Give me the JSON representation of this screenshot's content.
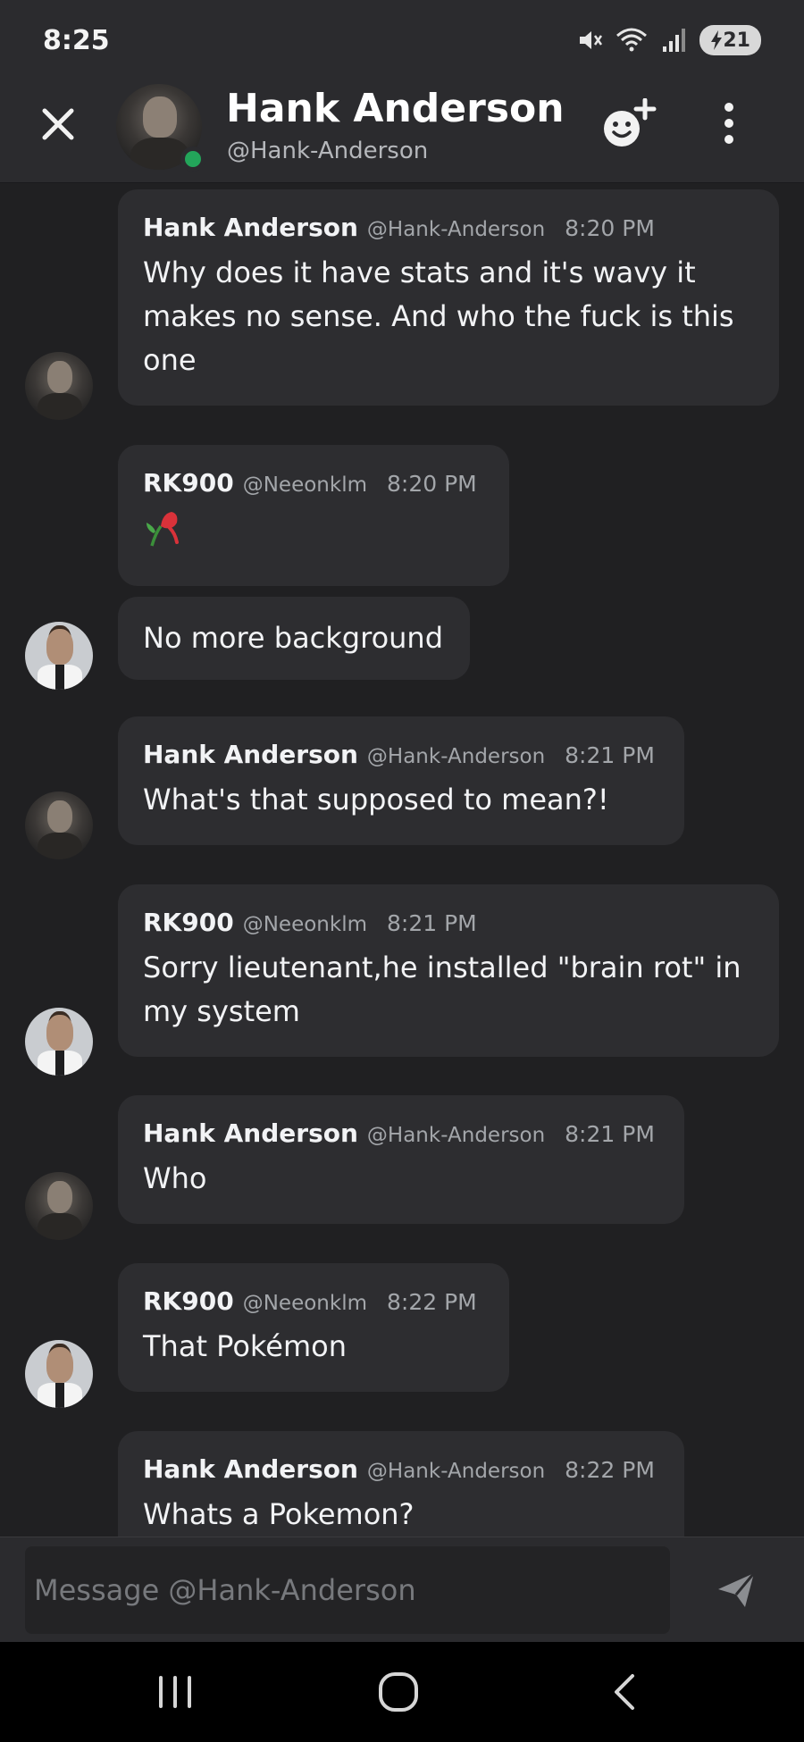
{
  "status_bar": {
    "time": "8:25",
    "battery": "21"
  },
  "header": {
    "name": "Hank Anderson",
    "handle": "@Hank-Anderson",
    "online_color": "#23a55a",
    "icons": {
      "close": "close-icon",
      "add_friend": "add-friend-icon",
      "more": "more-vertical-icon"
    }
  },
  "messages": [
    {
      "author": "Hank Anderson",
      "handle": "@Hank-Anderson",
      "time": "8:20 PM",
      "text": "Why does it have stats and it's wavy it makes no sense. And who the fuck is this one"
    },
    {
      "author": "RK900",
      "handle": "@Neeonklm",
      "time": "8:20 PM",
      "text": "",
      "emoji": "wilted-rose"
    },
    {
      "author": "",
      "handle": "",
      "time": "",
      "text": "No more background"
    },
    {
      "author": "Hank Anderson",
      "handle": "@Hank-Anderson",
      "time": "8:21 PM",
      "text": "What's that supposed to mean?!"
    },
    {
      "author": "RK900",
      "handle": "@Neeonklm",
      "time": "8:21 PM",
      "text": "Sorry lieutenant,he installed \"brain rot\" in my system"
    },
    {
      "author": "Hank Anderson",
      "handle": "@Hank-Anderson",
      "time": "8:21 PM",
      "text": "Who"
    },
    {
      "author": "RK900",
      "handle": "@Neeonklm",
      "time": "8:22 PM",
      "text": "That Pokémon"
    },
    {
      "author": "Hank Anderson",
      "handle": "@Hank-Anderson",
      "time": "8:22 PM",
      "text": "Whats a Pokemon?"
    }
  ],
  "composer": {
    "placeholder": "Message @Hank-Anderson",
    "send_icon": "send-icon"
  },
  "nav": {
    "recents_icon": "recents-icon",
    "home_icon": "home-icon",
    "back_icon": "back-icon"
  }
}
